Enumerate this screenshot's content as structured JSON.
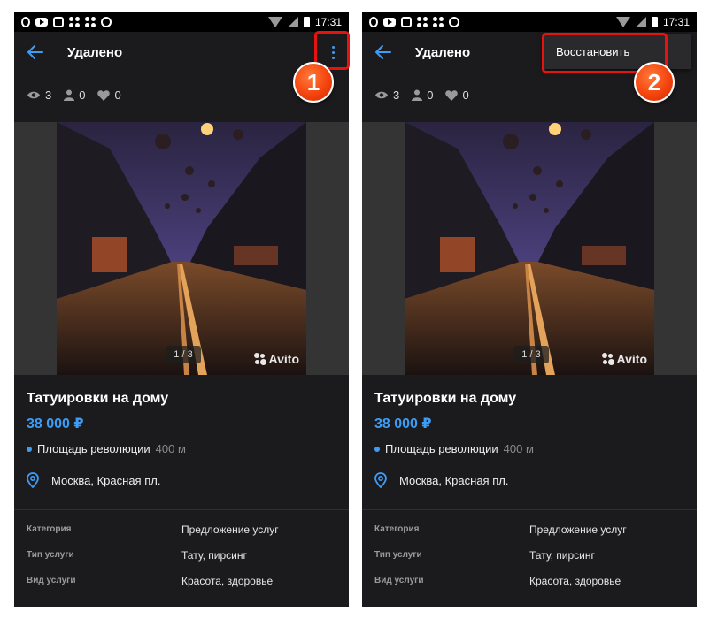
{
  "status_bar": {
    "time": "17:31"
  },
  "app_bar": {
    "title": "Удалено"
  },
  "stats": {
    "views": "3",
    "contacts": "0",
    "favorites": "0"
  },
  "gallery": {
    "counter": "1 / 3",
    "watermark": "Avito"
  },
  "ad": {
    "title": "Татуировки на дому",
    "price": "38 000 ₽",
    "metro_station": "Площадь революции",
    "metro_distance": "400 м",
    "address": "Москва, Красная пл."
  },
  "params": [
    {
      "label": "Категория",
      "value": "Предложение услуг"
    },
    {
      "label": "Тип услуги",
      "value": "Тату, пирсинг"
    },
    {
      "label": "Вид услуги",
      "value": "Красота, здоровье"
    }
  ],
  "menu": {
    "restore_label": "Восстановить"
  },
  "steps": {
    "step1": "1",
    "step2": "2"
  },
  "colors": {
    "accent": "#3d9df6",
    "highlight": "#e8130f",
    "background": "#1b1b1d",
    "badge": "#f5440e"
  }
}
